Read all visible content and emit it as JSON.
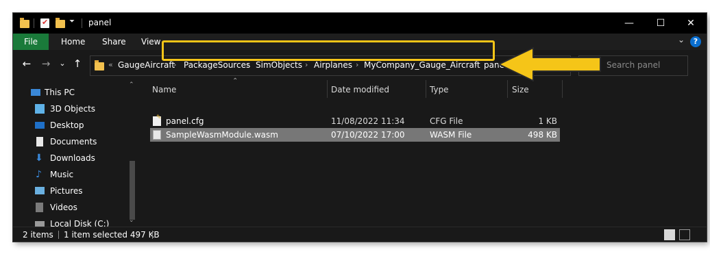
{
  "window": {
    "title": "panel",
    "controls": {
      "minimize": "—",
      "maximize": "☐",
      "close": "✕"
    }
  },
  "ribbon": {
    "tabs": [
      "File",
      "Home",
      "Share",
      "View"
    ],
    "help": "?",
    "collapse_chevron": "⌄"
  },
  "nav": {
    "back": "←",
    "forward": "→",
    "recent": "⌄",
    "up": "↑"
  },
  "address": {
    "overflow": "«",
    "crumbs": [
      "GaugeAircraft",
      "PackageSources",
      "SimObjects",
      "Airplanes",
      "MyCompany_Gauge_Aircraft",
      "panel"
    ],
    "separator": "›"
  },
  "search": {
    "placeholder": "Search panel"
  },
  "sidebar": {
    "items": [
      {
        "label": "This PC",
        "icon": "this-pc-icon"
      },
      {
        "label": "3D Objects",
        "icon": "3d-objects-icon"
      },
      {
        "label": "Desktop",
        "icon": "desktop-icon"
      },
      {
        "label": "Documents",
        "icon": "documents-icon"
      },
      {
        "label": "Downloads",
        "icon": "downloads-icon"
      },
      {
        "label": "Music",
        "icon": "music-icon"
      },
      {
        "label": "Pictures",
        "icon": "pictures-icon"
      },
      {
        "label": "Videos",
        "icon": "videos-icon"
      },
      {
        "label": "Local Disk (C:)",
        "icon": "local-disk-icon"
      }
    ]
  },
  "filelist": {
    "columns": [
      "Name",
      "Date modified",
      "Type",
      "Size"
    ],
    "rows": [
      {
        "name": "panel.cfg",
        "date": "11/08/2022 11:34",
        "type": "CFG File",
        "size": "1 KB",
        "selected": false
      },
      {
        "name": "SampleWasmModule.wasm",
        "date": "07/10/2022 17:00",
        "type": "WASM File",
        "size": "498 KB",
        "selected": true
      }
    ]
  },
  "status": {
    "items": "2 items",
    "selected": "1 item selected  497 KB"
  },
  "colors": {
    "accent_file_tab": "#1a7a3a",
    "highlight": "#f5c518",
    "background": "#191919"
  }
}
